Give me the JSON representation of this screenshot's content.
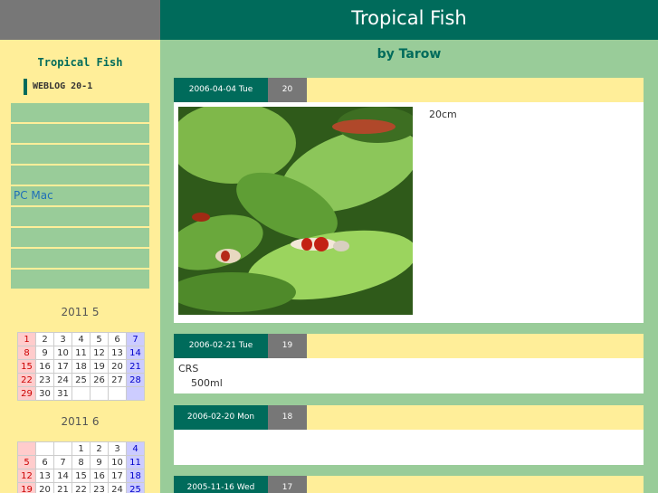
{
  "header": {
    "site_title": "Tropical Fish"
  },
  "sidebar": {
    "title": "Tropical Fish",
    "subtitle": "WEBLOG 20-1",
    "menu": [
      "",
      "",
      "",
      "",
      "PC Mac",
      "",
      "",
      "",
      ""
    ]
  },
  "calendars": [
    {
      "title": "2011 5",
      "weeks": [
        [
          "1",
          "2",
          "3",
          "4",
          "5",
          "6",
          "7"
        ],
        [
          "8",
          "9",
          "10",
          "11",
          "12",
          "13",
          "14"
        ],
        [
          "15",
          "16",
          "17",
          "18",
          "19",
          "20",
          "21"
        ],
        [
          "22",
          "23",
          "24",
          "25",
          "26",
          "27",
          "28"
        ],
        [
          "29",
          "30",
          "31",
          "",
          "",
          "",
          ""
        ]
      ]
    },
    {
      "title": "2011 6",
      "weeks": [
        [
          "",
          "",
          "",
          "1",
          "2",
          "3",
          "4"
        ],
        [
          "5",
          "6",
          "7",
          "8",
          "9",
          "10",
          "11"
        ],
        [
          "12",
          "13",
          "14",
          "15",
          "16",
          "17",
          "18"
        ],
        [
          "19",
          "20",
          "21",
          "22",
          "23",
          "24",
          "25"
        ]
      ]
    }
  ],
  "main": {
    "byline": "by Tarow",
    "entries": [
      {
        "date": "2006-04-04 Tue",
        "count": "20",
        "caption": "20cm"
      },
      {
        "date": "2006-02-21 Tue",
        "count": "19",
        "lines": [
          "CRS",
          "500ml"
        ]
      },
      {
        "date": "2006-02-20 Mon",
        "count": "18"
      },
      {
        "date": "2005-11-16 Wed",
        "count": "17"
      }
    ]
  },
  "colors": {
    "accent": "#006b5b",
    "page_bg": "#99cc99",
    "sidebar_bg": "#ffee99",
    "gray": "#777777"
  }
}
